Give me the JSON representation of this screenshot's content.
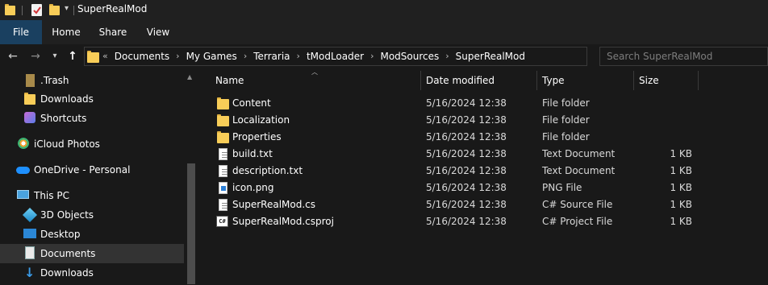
{
  "window": {
    "title": "SuperRealMod"
  },
  "ribbon": {
    "tabs": [
      "File",
      "Home",
      "Share",
      "View"
    ]
  },
  "address": {
    "overflow": "«",
    "crumbs": [
      "Documents",
      "My Games",
      "Terraria",
      "tModLoader",
      "ModSources",
      "SuperRealMod"
    ]
  },
  "search": {
    "placeholder": "Search SuperRealMod"
  },
  "nav": {
    "items": [
      {
        "label": ".Trash",
        "icon": "trash-folder-icon"
      },
      {
        "label": "Downloads",
        "icon": "folder-icon"
      },
      {
        "label": "Shortcuts",
        "icon": "shortcuts-icon"
      },
      {
        "label": "iCloud Photos",
        "icon": "icloud-photos-icon"
      },
      {
        "label": "OneDrive - Personal",
        "icon": "onedrive-icon"
      },
      {
        "label": "This PC",
        "icon": "computer-icon"
      },
      {
        "label": "3D Objects",
        "icon": "3d-objects-icon"
      },
      {
        "label": "Desktop",
        "icon": "desktop-icon"
      },
      {
        "label": "Documents",
        "icon": "documents-icon"
      },
      {
        "label": "Downloads",
        "icon": "download-arrow-icon"
      }
    ]
  },
  "columns": {
    "name": "Name",
    "date": "Date modified",
    "type": "Type",
    "size": "Size"
  },
  "files": [
    {
      "name": "Content",
      "date": "5/16/2024 12:38",
      "type": "File folder",
      "size": "",
      "icon": "folder-icon"
    },
    {
      "name": "Localization",
      "date": "5/16/2024 12:38",
      "type": "File folder",
      "size": "",
      "icon": "folder-icon"
    },
    {
      "name": "Properties",
      "date": "5/16/2024 12:38",
      "type": "File folder",
      "size": "",
      "icon": "folder-icon"
    },
    {
      "name": "build.txt",
      "date": "5/16/2024 12:38",
      "type": "Text Document",
      "size": "1 KB",
      "icon": "text-file-icon"
    },
    {
      "name": "description.txt",
      "date": "5/16/2024 12:38",
      "type": "Text Document",
      "size": "1 KB",
      "icon": "text-file-icon"
    },
    {
      "name": "icon.png",
      "date": "5/16/2024 12:38",
      "type": "PNG File",
      "size": "1 KB",
      "icon": "png-file-icon"
    },
    {
      "name": "SuperRealMod.cs",
      "date": "5/16/2024 12:38",
      "type": "C# Source File",
      "size": "1 KB",
      "icon": "cs-file-icon"
    },
    {
      "name": "SuperRealMod.csproj",
      "date": "5/16/2024 12:38",
      "type": "C# Project File",
      "size": "1 KB",
      "icon": "csproj-file-icon"
    }
  ],
  "colors": {
    "folder": "#f8cd58",
    "file_tab_active": "#1a4060",
    "selected_nav": "#333333",
    "background": "#191919"
  }
}
